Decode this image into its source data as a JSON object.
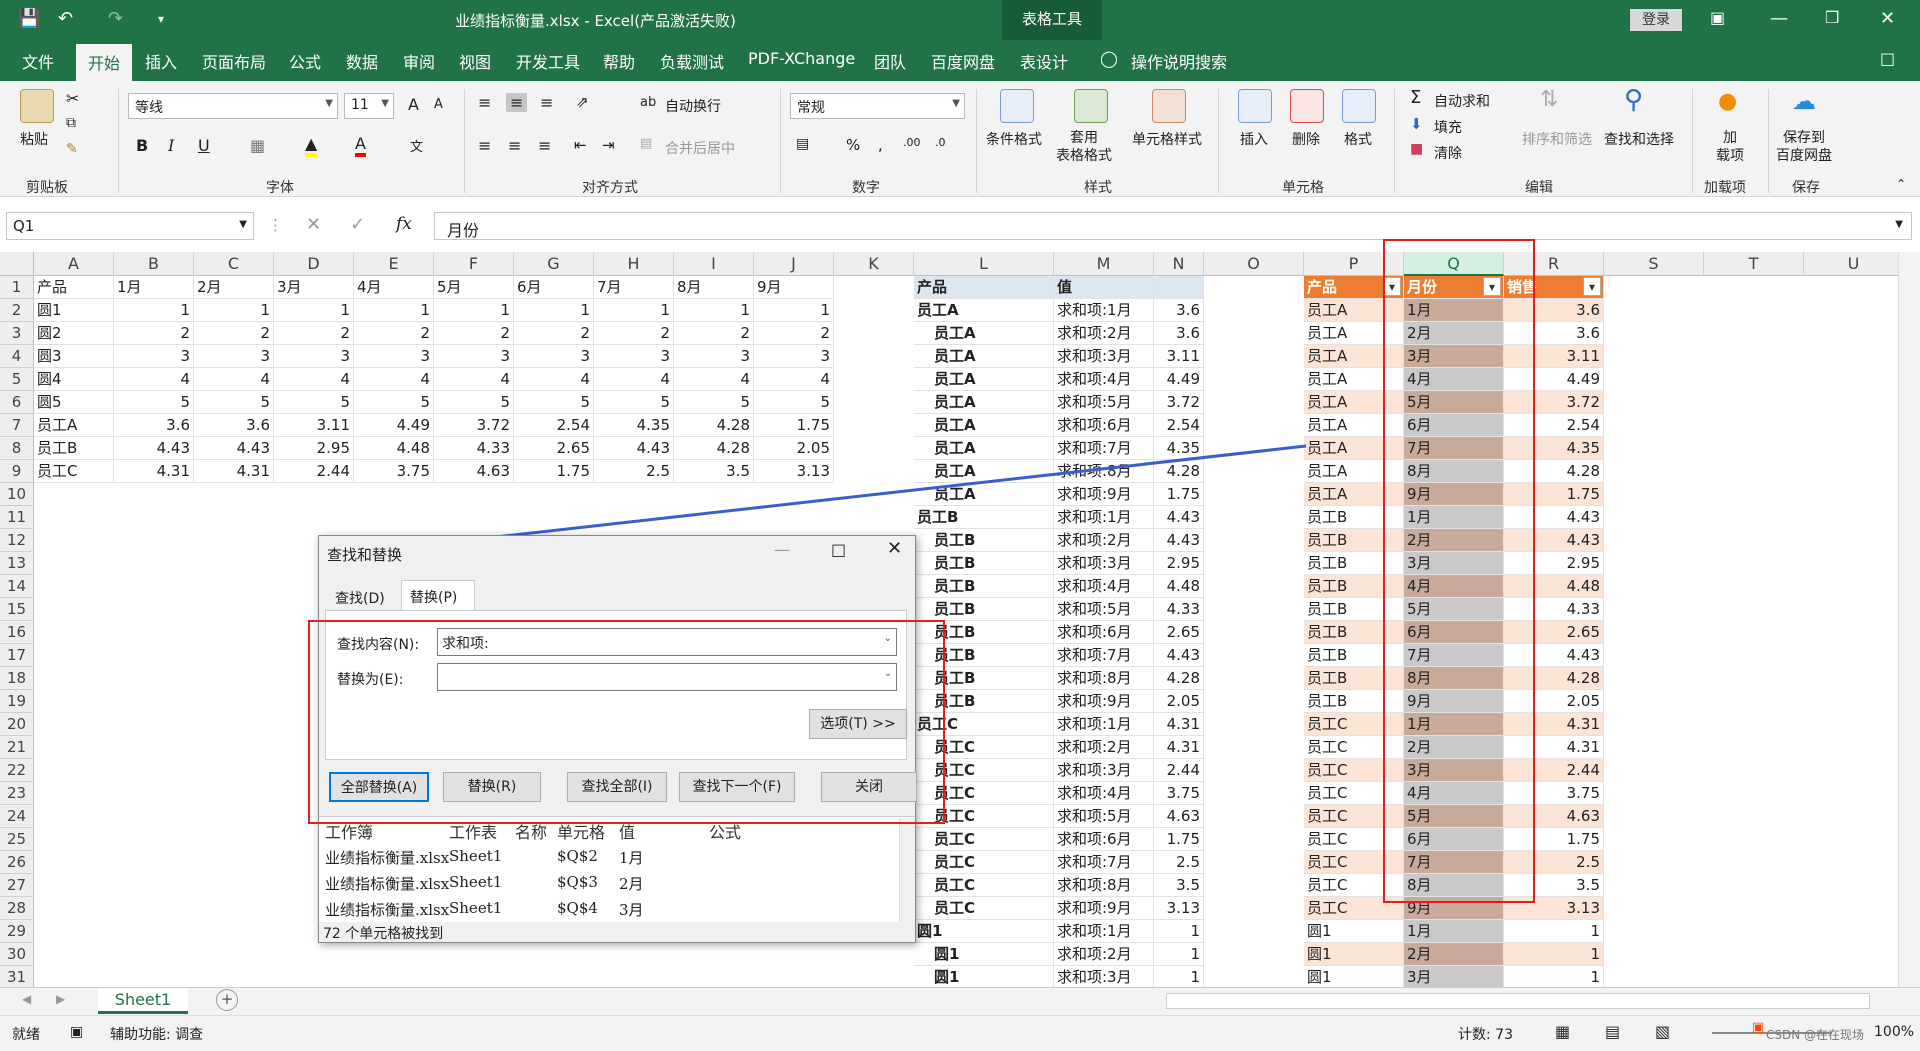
{
  "titlebar": {
    "filename_title": "业绩指标衡量.xlsx  -  Excel(产品激活失败)",
    "table_tools": "表格工具",
    "login": "登录"
  },
  "menu": {
    "items": [
      "文件",
      "开始",
      "插入",
      "页面布局",
      "公式",
      "数据",
      "审阅",
      "视图",
      "开发工具",
      "帮助",
      "负载测试",
      "PDF-XChange",
      "团队",
      "百度网盘",
      "表设计"
    ],
    "active": "开始",
    "search": "操作说明搜索"
  },
  "ribbon": {
    "clipboard": {
      "paste": "粘贴",
      "label": "剪贴板"
    },
    "font": {
      "name": "等线",
      "size": "11",
      "label": "字体",
      "bold": "B",
      "italic": "I",
      "underline": "U",
      "grow": "A",
      "shrink": "A"
    },
    "align": {
      "wrap": "自动换行",
      "merge": "合并后居中",
      "label": "对齐方式"
    },
    "number": {
      "format": "常规",
      "label": "数字"
    },
    "styles": {
      "cond": "条件格式",
      "table": "套用\n表格格式",
      "cell": "单元格样式",
      "label": "样式"
    },
    "cells": {
      "insert": "插入",
      "delete": "删除",
      "format": "格式",
      "label": "单元格"
    },
    "edit": {
      "autosum": "自动求和",
      "fill": "填充",
      "clear": "清除",
      "sort": "排序和筛选",
      "find": "查找和选择",
      "label": "编辑"
    },
    "addin": {
      "name": "加\n载项",
      "label": "加载项"
    },
    "save": {
      "name": "保存到\n百度网盘",
      "label": "保存"
    }
  },
  "formula_bar": {
    "name_box": "Q1",
    "cancel": "✕",
    "enter": "✓",
    "fx": "fx",
    "content": "月份"
  },
  "columns": [
    "A",
    "B",
    "C",
    "D",
    "E",
    "F",
    "G",
    "H",
    "I",
    "J",
    "K",
    "L",
    "M",
    "N",
    "O",
    "P",
    "Q",
    "R",
    "S",
    "T",
    "U"
  ],
  "rows": [
    "1",
    "2",
    "3",
    "4",
    "5",
    "6",
    "7",
    "8",
    "9",
    "10",
    "11",
    "12",
    "13",
    "14",
    "15",
    "16",
    "17",
    "18",
    "19",
    "20",
    "21",
    "22",
    "23",
    "24",
    "25",
    "26",
    "27",
    "28",
    "29",
    "30",
    "31"
  ],
  "left_table": {
    "header": [
      "产品",
      "1月",
      "2月",
      "3月",
      "4月",
      "5月",
      "6月",
      "7月",
      "8月",
      "9月"
    ],
    "rows": [
      [
        "圆1",
        "1",
        "1",
        "1",
        "1",
        "1",
        "1",
        "1",
        "1",
        "1"
      ],
      [
        "圆2",
        "2",
        "2",
        "2",
        "2",
        "2",
        "2",
        "2",
        "2",
        "2"
      ],
      [
        "圆3",
        "3",
        "3",
        "3",
        "3",
        "3",
        "3",
        "3",
        "3",
        "3"
      ],
      [
        "圆4",
        "4",
        "4",
        "4",
        "4",
        "4",
        "4",
        "4",
        "4",
        "4"
      ],
      [
        "圆5",
        "5",
        "5",
        "5",
        "5",
        "5",
        "5",
        "5",
        "5",
        "5"
      ],
      [
        "员工A",
        "3.6",
        "3.6",
        "3.11",
        "4.49",
        "3.72",
        "2.54",
        "4.35",
        "4.28",
        "1.75"
      ],
      [
        "员工B",
        "4.43",
        "4.43",
        "2.95",
        "4.48",
        "4.33",
        "2.65",
        "4.43",
        "4.28",
        "2.05"
      ],
      [
        "员工C",
        "4.31",
        "4.31",
        "2.44",
        "3.75",
        "4.63",
        "1.75",
        "2.5",
        "3.5",
        "3.13"
      ]
    ]
  },
  "pivot": {
    "header": [
      "产品",
      "值"
    ],
    "rows": [
      [
        "员工A",
        "求和项:1月",
        "3.6"
      ],
      [
        "员工A",
        "求和项:2月",
        "3.6"
      ],
      [
        "员工A",
        "求和项:3月",
        "3.11"
      ],
      [
        "员工A",
        "求和项:4月",
        "4.49"
      ],
      [
        "员工A",
        "求和项:5月",
        "3.72"
      ],
      [
        "员工A",
        "求和项:6月",
        "2.54"
      ],
      [
        "员工A",
        "求和项:7月",
        "4.35"
      ],
      [
        "员工A",
        "求和项:8月",
        "4.28"
      ],
      [
        "员工A",
        "求和项:9月",
        "1.75"
      ],
      [
        "员工B",
        "求和项:1月",
        "4.43"
      ],
      [
        "员工B",
        "求和项:2月",
        "4.43"
      ],
      [
        "员工B",
        "求和项:3月",
        "2.95"
      ],
      [
        "员工B",
        "求和项:4月",
        "4.48"
      ],
      [
        "员工B",
        "求和项:5月",
        "4.33"
      ],
      [
        "员工B",
        "求和项:6月",
        "2.65"
      ],
      [
        "员工B",
        "求和项:7月",
        "4.43"
      ],
      [
        "员工B",
        "求和项:8月",
        "4.28"
      ],
      [
        "员工B",
        "求和项:9月",
        "2.05"
      ],
      [
        "员工C",
        "求和项:1月",
        "4.31"
      ],
      [
        "员工C",
        "求和项:2月",
        "4.31"
      ],
      [
        "员工C",
        "求和项:3月",
        "2.44"
      ],
      [
        "员工C",
        "求和项:4月",
        "3.75"
      ],
      [
        "员工C",
        "求和项:5月",
        "4.63"
      ],
      [
        "员工C",
        "求和项:6月",
        "1.75"
      ],
      [
        "员工C",
        "求和项:7月",
        "2.5"
      ],
      [
        "员工C",
        "求和项:8月",
        "3.5"
      ],
      [
        "员工C",
        "求和项:9月",
        "3.13"
      ],
      [
        "圆1",
        "求和项:1月",
        "1"
      ],
      [
        "圆1",
        "求和项:2月",
        "1"
      ],
      [
        "圆1",
        "求和项:3月",
        "1"
      ]
    ]
  },
  "table": {
    "header": [
      "产品",
      "月份",
      "销售"
    ],
    "rows": [
      [
        "员工A",
        "1月",
        "3.6"
      ],
      [
        "员工A",
        "2月",
        "3.6"
      ],
      [
        "员工A",
        "3月",
        "3.11"
      ],
      [
        "员工A",
        "4月",
        "4.49"
      ],
      [
        "员工A",
        "5月",
        "3.72"
      ],
      [
        "员工A",
        "6月",
        "2.54"
      ],
      [
        "员工A",
        "7月",
        "4.35"
      ],
      [
        "员工A",
        "8月",
        "4.28"
      ],
      [
        "员工A",
        "9月",
        "1.75"
      ],
      [
        "员工B",
        "1月",
        "4.43"
      ],
      [
        "员工B",
        "2月",
        "4.43"
      ],
      [
        "员工B",
        "3月",
        "2.95"
      ],
      [
        "员工B",
        "4月",
        "4.48"
      ],
      [
        "员工B",
        "5月",
        "4.33"
      ],
      [
        "员工B",
        "6月",
        "2.65"
      ],
      [
        "员工B",
        "7月",
        "4.43"
      ],
      [
        "员工B",
        "8月",
        "4.28"
      ],
      [
        "员工B",
        "9月",
        "2.05"
      ],
      [
        "员工C",
        "1月",
        "4.31"
      ],
      [
        "员工C",
        "2月",
        "4.31"
      ],
      [
        "员工C",
        "3月",
        "2.44"
      ],
      [
        "员工C",
        "4月",
        "3.75"
      ],
      [
        "员工C",
        "5月",
        "4.63"
      ],
      [
        "员工C",
        "6月",
        "1.75"
      ],
      [
        "员工C",
        "7月",
        "2.5"
      ],
      [
        "员工C",
        "8月",
        "3.5"
      ],
      [
        "员工C",
        "9月",
        "3.13"
      ],
      [
        "圆1",
        "1月",
        "1"
      ],
      [
        "圆1",
        "2月",
        "1"
      ],
      [
        "圆1",
        "3月",
        "1"
      ]
    ]
  },
  "dialog": {
    "title": "查找和替换",
    "tab_find": "查找(D)",
    "tab_replace": "替换(P)",
    "find_label": "查找内容(N):",
    "find_value": "求和项:",
    "replace_label": "替换为(E):",
    "replace_value": "",
    "options": "选项(T) >>",
    "replace_all": "全部替换(A)",
    "replace": "替换(R)",
    "find_all": "查找全部(I)",
    "find_next": "查找下一个(F)",
    "close": "关闭",
    "results_header": [
      "工作簿",
      "工作表",
      "名称",
      "单元格",
      "值",
      "公式"
    ],
    "results": [
      [
        "业绩指标衡量.xlsx",
        "Sheet1",
        "",
        "$Q$2",
        "1月",
        ""
      ],
      [
        "业绩指标衡量.xlsx",
        "Sheet1",
        "",
        "$Q$3",
        "2月",
        ""
      ],
      [
        "业绩指标衡量.xlsx",
        "Sheet1",
        "",
        "$Q$4",
        "3月",
        ""
      ]
    ],
    "status": "72 个单元格被找到"
  },
  "sheetbar": {
    "tab": "Sheet1",
    "add": "+"
  },
  "statusbar": {
    "ready": "就绪",
    "accessibility": "辅助功能: 调查",
    "count": "计数: 73",
    "zoom": "100%",
    "watermark": "CSDN @在在现场"
  },
  "colors": {
    "excel_green": "#217346",
    "table_header": "#ed7d31",
    "band": "#fce4d6",
    "pivot_header": "#dce6f1",
    "highlight_red": "#e02020",
    "arrow_blue": "#3a5fcd"
  }
}
